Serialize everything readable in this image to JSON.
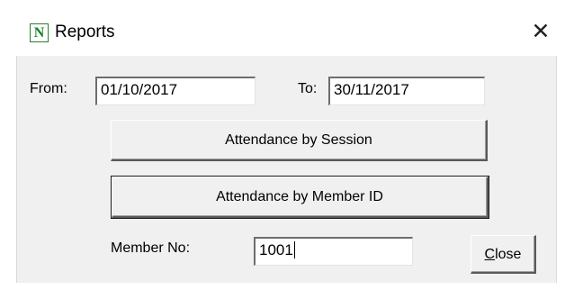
{
  "window": {
    "icon_letter": "N",
    "title": "Reports",
    "close_glyph": "✕"
  },
  "filters": {
    "from_label": "From:",
    "from_value": "01/10/2017",
    "to_label": "To:",
    "to_value": "30/11/2017"
  },
  "buttons": {
    "attendance_by_session": "Attendance by Session",
    "attendance_by_member": "Attendance by Member ID",
    "close_mnemonic": "C",
    "close_rest": "lose"
  },
  "member": {
    "label": "Member No:",
    "value": "1001"
  },
  "icons": {
    "app": "app-n-icon",
    "close": "close-icon"
  },
  "colors": {
    "client_background": "#f0f0f0",
    "icon_green": "#1a7f2a"
  }
}
